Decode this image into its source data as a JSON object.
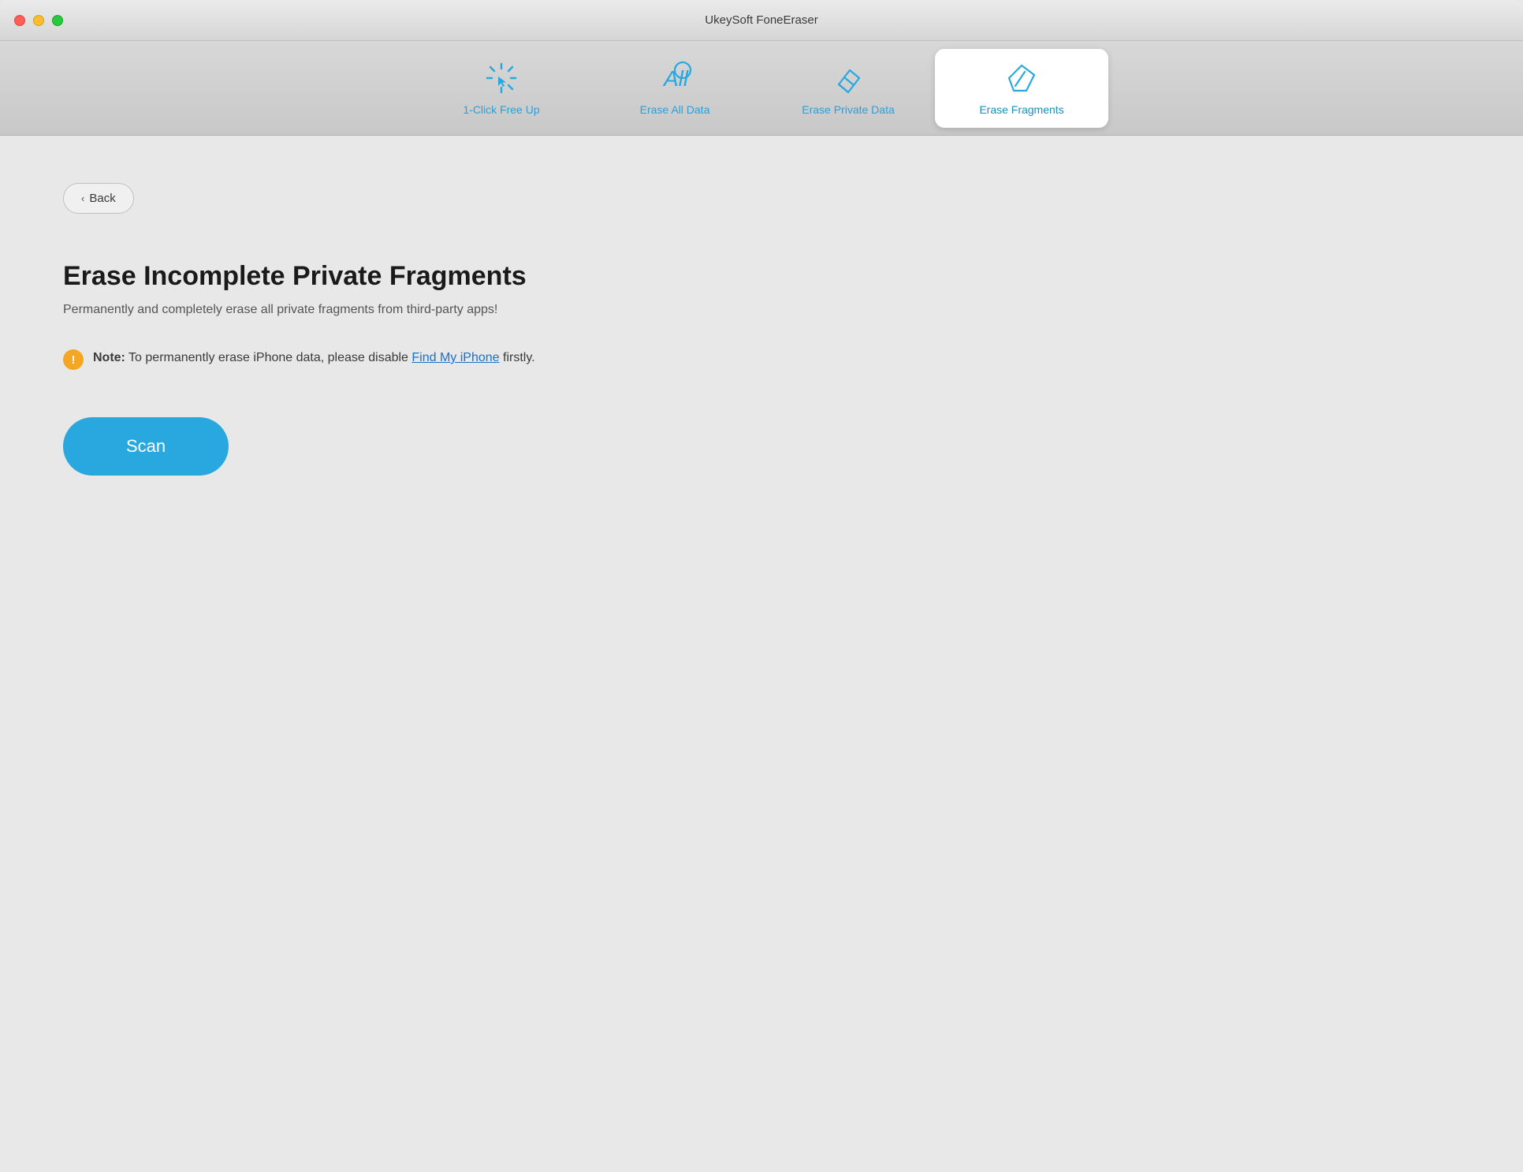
{
  "window": {
    "title": "UkeySoft FoneEraser"
  },
  "traffic_lights": {
    "red_label": "close",
    "yellow_label": "minimize",
    "green_label": "maximize"
  },
  "tabs": [
    {
      "id": "one-click-free-up",
      "label": "1-Click Free Up",
      "icon": "cursor-click-icon",
      "active": false
    },
    {
      "id": "erase-all-data",
      "label": "Erase All Data",
      "icon": "erase-all-icon",
      "active": false
    },
    {
      "id": "erase-private-data",
      "label": "Erase Private Data",
      "icon": "erase-private-icon",
      "active": false
    },
    {
      "id": "erase-fragments",
      "label": "Erase Fragments",
      "icon": "erase-fragments-icon",
      "active": true
    }
  ],
  "back_button": {
    "label": "Back"
  },
  "main": {
    "heading": "Erase Incomplete Private Fragments",
    "subheading": "Permanently and completely erase all private fragments from third-party apps!",
    "note_label": "Note:",
    "note_text": " To permanently erase iPhone data, please disable ",
    "note_link": "Find My iPhone",
    "note_suffix": " firstly.",
    "scan_button_label": "Scan"
  }
}
